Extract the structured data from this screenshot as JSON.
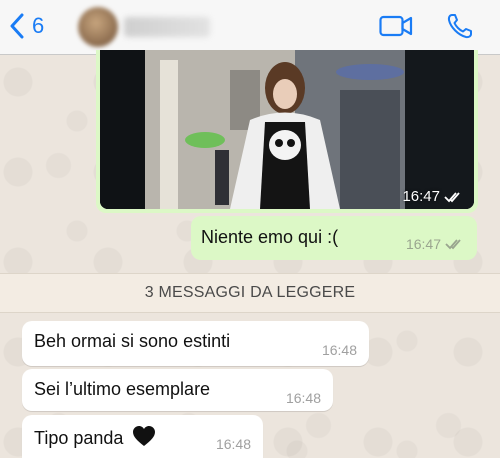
{
  "nav": {
    "back_count": "6"
  },
  "messages": {
    "photo_time": "16:47",
    "sent_text": "Niente emo qui :(",
    "sent_time": "16:47",
    "unread_label": "3 MESSAGGI DA LEGGERE",
    "received": [
      {
        "text": "Beh ormai si sono estinti",
        "time": "16:48"
      },
      {
        "text": "Sei l’ultimo esemplare",
        "time": "16:48"
      },
      {
        "text": "Tipo panda",
        "time": "16:48"
      }
    ]
  },
  "colors": {
    "accent": "#1a7cf5",
    "outgoing_bubble": "#dcf8c6",
    "incoming_bubble": "#ffffff",
    "read_ticks": "#9aa58f"
  },
  "icons": [
    "chevron-left-icon",
    "video-camera-icon",
    "phone-icon",
    "double-check-icon",
    "black-heart-icon"
  ]
}
